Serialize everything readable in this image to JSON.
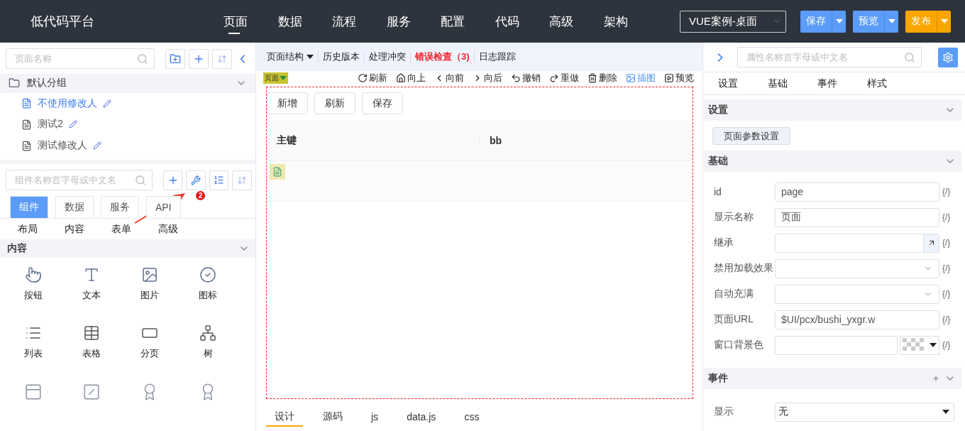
{
  "header": {
    "title": "低代码平台",
    "nav": [
      {
        "label": "页面",
        "selected": true
      },
      {
        "label": "数据",
        "selected": false
      },
      {
        "label": "流程",
        "selected": false
      },
      {
        "label": "服务",
        "selected": false
      },
      {
        "label": "配置",
        "selected": false
      },
      {
        "label": "代码",
        "selected": false
      },
      {
        "label": "高级",
        "selected": false
      },
      {
        "label": "架构",
        "selected": false
      }
    ],
    "project_select": "VUE案例-桌面",
    "actions": [
      {
        "label": "保存",
        "kind": "primary"
      },
      {
        "label": "预览",
        "kind": "primary"
      },
      {
        "label": "发布",
        "kind": "warning"
      }
    ]
  },
  "pages_panel": {
    "search": {
      "placeholder": "页面名称"
    },
    "group": {
      "label": "默认分组",
      "expanded": true
    },
    "pages": [
      {
        "label": "不使用修改人",
        "selected": true
      },
      {
        "label": "测试2",
        "selected": false
      },
      {
        "label": "测试修改人",
        "selected": false
      }
    ]
  },
  "components_panel": {
    "search": {
      "placeholder": "组件名称首字母或中文名"
    },
    "annotation": "2",
    "tabs": [
      {
        "label": "组件",
        "selected": true
      },
      {
        "label": "数据",
        "selected": false
      },
      {
        "label": "服务",
        "selected": false
      },
      {
        "label": "API",
        "selected": false
      }
    ],
    "categories": [
      "布局",
      "内容",
      "表单",
      "高级"
    ],
    "section": {
      "label": "内容",
      "expanded": true
    },
    "items": [
      "按钮",
      "文本",
      "图片",
      "图标",
      "列表",
      "表格",
      "分页",
      "树"
    ]
  },
  "editor": {
    "toolbar": [
      {
        "label": "页面结构",
        "kind": "menu"
      },
      {
        "label": "历史版本",
        "kind": "plain"
      },
      {
        "label": "处理冲突",
        "kind": "plain"
      },
      {
        "label": "错误检查（3)",
        "kind": "error"
      },
      {
        "label": "日志跟踪",
        "kind": "plain"
      }
    ],
    "page_tag": "页面",
    "actions": [
      {
        "label": "刷新",
        "active": false
      },
      {
        "label": "向上",
        "active": false
      },
      {
        "label": "向前",
        "active": false
      },
      {
        "label": "向后",
        "active": false
      },
      {
        "label": "撤销",
        "active": false
      },
      {
        "label": "重做",
        "active": false
      },
      {
        "label": "删除",
        "active": false
      },
      {
        "label": "插图",
        "active": true
      },
      {
        "label": "预览",
        "active": false
      }
    ],
    "buttons": [
      "新增",
      "刷新",
      "保存"
    ],
    "table": {
      "columns": [
        "主键",
        "bb"
      ]
    },
    "bottom_tabs": [
      {
        "label": "设计",
        "selected": true
      },
      {
        "label": "源码",
        "selected": false
      },
      {
        "label": "js",
        "selected": false
      },
      {
        "label": "data.js",
        "selected": false
      },
      {
        "label": "css",
        "selected": false
      }
    ]
  },
  "properties": {
    "search": {
      "placeholder": "属性名称首字母或中文名"
    },
    "tabs": [
      {
        "label": "设置",
        "selected": false
      },
      {
        "label": "基础",
        "selected": false
      },
      {
        "label": "事件",
        "selected": false
      },
      {
        "label": "样式",
        "selected": false
      }
    ],
    "settings": {
      "label": "设置",
      "button": "页面参数设置"
    },
    "basic": {
      "label": "基础",
      "fields": [
        {
          "label": "id",
          "kind": "text",
          "value": "page"
        },
        {
          "label": "显示名称",
          "kind": "text",
          "value": "页面"
        },
        {
          "label": "继承",
          "kind": "link"
        },
        {
          "label": "禁用加载效果",
          "kind": "select"
        },
        {
          "label": "自动充满",
          "kind": "select"
        },
        {
          "label": "页面URL",
          "kind": "text",
          "value": "$UI/pcx/bushi_yxgr.w"
        },
        {
          "label": "窗口背景色",
          "kind": "color"
        }
      ]
    },
    "events": {
      "label": "事件",
      "fields": [
        {
          "label": "显示",
          "value": "无"
        }
      ]
    },
    "expr": "{/}"
  }
}
